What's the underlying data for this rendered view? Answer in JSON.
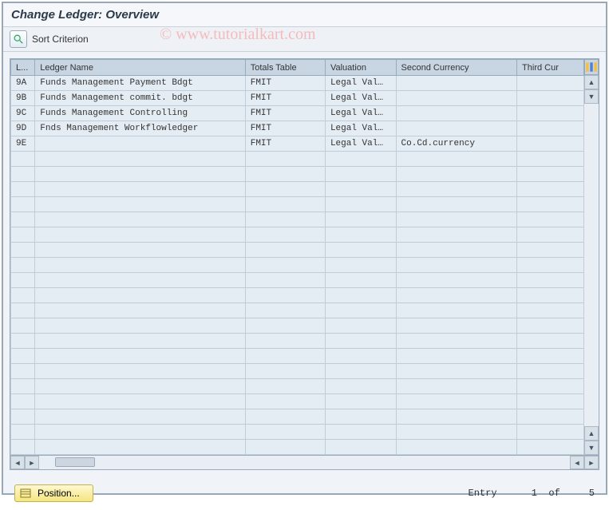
{
  "title": "Change Ledger: Overview",
  "toolbar": {
    "sort_label": "Sort Criterion"
  },
  "watermark": "© www.tutorialkart.com",
  "table": {
    "headers": {
      "l": "L...",
      "name": "Ledger Name",
      "totals": "Totals Table",
      "valuation": "Valuation",
      "second": "Second Currency",
      "third": "Third Cur"
    },
    "rows": [
      {
        "l": "9A",
        "name": "Funds Management Payment Bdgt",
        "totals": "FMIT",
        "valuation": "Legal Val…",
        "second": "",
        "third": ""
      },
      {
        "l": "9B",
        "name": "Funds Management commit. bdgt",
        "totals": "FMIT",
        "valuation": "Legal Val…",
        "second": "",
        "third": ""
      },
      {
        "l": "9C",
        "name": "Funds Management Controlling",
        "totals": "FMIT",
        "valuation": "Legal Val…",
        "second": "",
        "third": ""
      },
      {
        "l": "9D",
        "name": "Fnds Management Workflowledger",
        "totals": "FMIT",
        "valuation": "Legal Val…",
        "second": "",
        "third": ""
      },
      {
        "l": "9E",
        "name": "",
        "totals": "FMIT",
        "valuation": "Legal Val…",
        "second": "Co.Cd.currency",
        "third": ""
      }
    ],
    "empty_row_count": 20
  },
  "footer": {
    "position_label": "Position...",
    "entry_label": "Entry",
    "entry_current": "1",
    "entry_of": "of",
    "entry_total": "5"
  }
}
